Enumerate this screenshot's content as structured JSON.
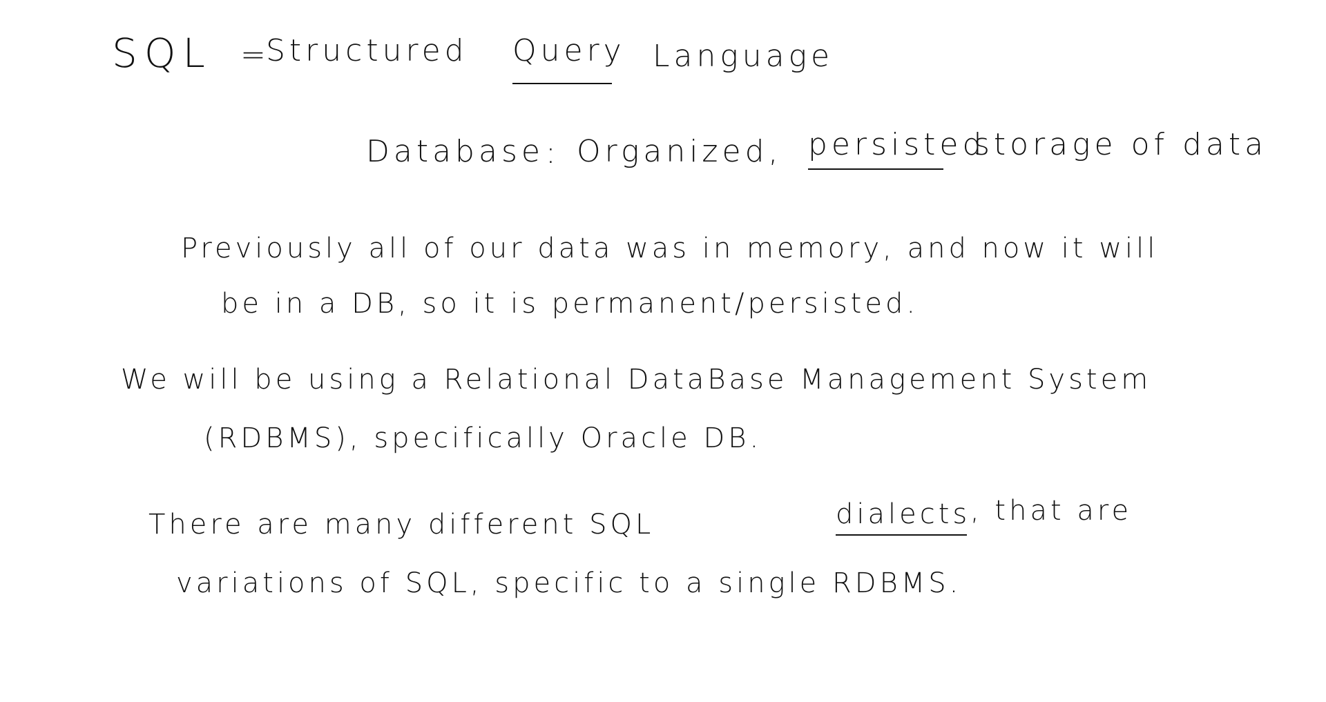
{
  "note": {
    "title_sql": "SQL",
    "title_eq": "=",
    "title_structured": "Structured",
    "title_query": "Query",
    "title_language": "Language",
    "def_database": "Database",
    "def_colon": ":",
    "def_organized": "Organized,",
    "def_persisted": "persisted",
    "def_storage": "storage of data",
    "p1_line1": "Previously all of our data was  in memory, and   now   it will",
    "p1_line2": "be  in  a  DB,  so   it   is   permanent/persisted.",
    "p2_line1": "We  will  be   using   a   Relational  DataBase  Management  System",
    "p2_line2": "(RDBMS),  specifically  Oracle  DB.",
    "p3_line1_a": "There   are    many  different   SQL",
    "p3_dialects": "dialects",
    "p3_line1_b": ",  that    are",
    "p3_line2": "variations  of  SQL, specific  to  a  single  RDBMS."
  }
}
